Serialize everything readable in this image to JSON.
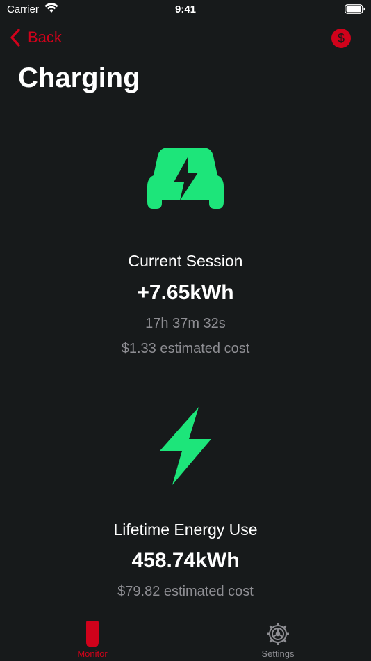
{
  "colors": {
    "accent": "#d0021b",
    "energy": "#1de57a",
    "background": "#171a1b",
    "secondary_text": "#8e8e93"
  },
  "status_bar": {
    "carrier": "Carrier",
    "time": "9:41",
    "icons": [
      "wifi-icon",
      "battery-icon"
    ]
  },
  "nav": {
    "back_label": "Back",
    "cost_icon_symbol": "$",
    "title": "Charging"
  },
  "current_session": {
    "icon": "car-charging-icon",
    "title": "Current Session",
    "energy": "+7.65kWh",
    "duration": "17h 37m 32s",
    "cost": "$1.33 estimated cost"
  },
  "lifetime": {
    "icon": "lightning-bolt-icon",
    "title": "Lifetime Energy Use",
    "energy": "458.74kWh",
    "cost": "$79.82 estimated cost"
  },
  "tabs": [
    {
      "label": "Monitor",
      "icon": "monitor-icon",
      "selected": true
    },
    {
      "label": "Settings",
      "icon": "gear-icon",
      "selected": false
    }
  ]
}
